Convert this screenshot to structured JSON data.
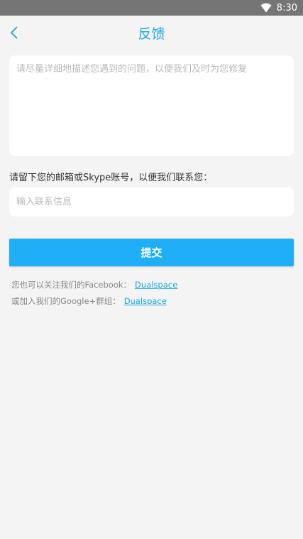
{
  "status_bar": {
    "time": "8:30",
    "wifi_icon": "wifi-icon"
  },
  "header": {
    "title": "反馈",
    "back_icon": "chevron-left-icon"
  },
  "feedback": {
    "placeholder": "请尽量详细地描述您遇到的问题，以便我们及时为您修复",
    "value": ""
  },
  "contact": {
    "label": "请留下您的邮箱或Skype账号，以便我们联系您：",
    "placeholder": "输入联系信息",
    "value": ""
  },
  "submit": {
    "label": "提交"
  },
  "social": {
    "facebook_text": "您也可以关注我们的Facebook：",
    "facebook_link": "Dualspace",
    "google_text": "或加入我们的Google+群组：",
    "google_link": "Dualspace"
  },
  "colors": {
    "accent": "#1ba6e8",
    "button": "#1eaff8",
    "status_bar": "#757575",
    "background": "#f4f4f4"
  }
}
